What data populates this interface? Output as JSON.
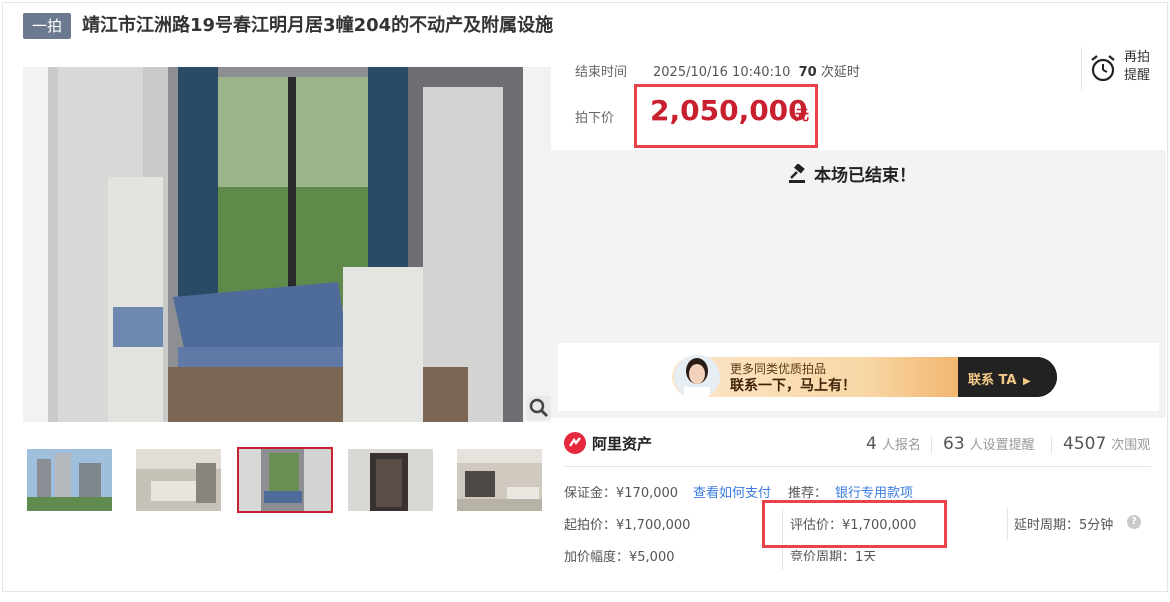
{
  "header": {
    "tag": "一拍",
    "title": "靖江市江洲路19号春江明月居3幢204的不动产及附属设施"
  },
  "auction": {
    "end_time_label": "结束时间",
    "end_time_value": "2025/10/16 10:40:10",
    "delay_count": "70",
    "delay_suffix": "次延时",
    "remind_label_1": "再拍",
    "remind_label_2": "提醒",
    "price_label": "拍下价",
    "price_value": "2,050,000",
    "price_unit": "元",
    "ended_text": "本场已结束！"
  },
  "promo": {
    "small_text": "更多同类优质拍品",
    "big_text": "联系一下，马上有！",
    "cta": "联系 TA"
  },
  "seller": {
    "name": "阿里资产"
  },
  "stats": {
    "signups": "4",
    "signups_label": "人报名",
    "reminders": "63",
    "reminders_label": "人设置提醒",
    "views": "4507",
    "views_label": "次围观"
  },
  "details": {
    "deposit": "保证金：¥170,000",
    "pay_link": "查看如何支付",
    "recommend_label": "推荐：",
    "recommend_link": "银行专用款项",
    "start_price": "起拍价：¥1,700,000",
    "eval_price": "评估价：¥1,700,000",
    "delay_period": "延时周期：5分钟",
    "increment": "加价幅度：¥5,000",
    "bid_period": "竞价周期：1天"
  },
  "colors": {
    "accent_red": "#c8202e",
    "highlight_box": "#e8424a",
    "tag_bg": "#6b7a90",
    "link": "#3a7be0"
  },
  "icons": {
    "alarm": "alarm-clock-icon",
    "gavel": "gavel-icon",
    "zoom": "magnifier-icon",
    "help": "question-icon",
    "seller": "ali-assets-logo"
  }
}
